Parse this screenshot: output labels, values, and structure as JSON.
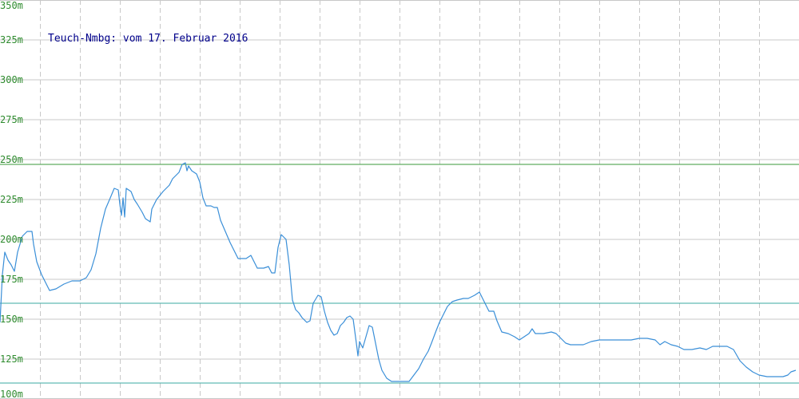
{
  "chart_data": {
    "type": "line",
    "title": "Teuch-Nmbg: vom 17. Februar 2016",
    "xlabel": "",
    "ylabel": "",
    "ylim": [
      100,
      350
    ],
    "y_ticks": [
      {
        "value": 350,
        "label": "350m"
      },
      {
        "value": 325,
        "label": "325m"
      },
      {
        "value": 300,
        "label": "300m"
      },
      {
        "value": 275,
        "label": "275m"
      },
      {
        "value": 250,
        "label": "250m"
      },
      {
        "value": 225,
        "label": "225m"
      },
      {
        "value": 200,
        "label": "200m"
      },
      {
        "value": 175,
        "label": "175m"
      },
      {
        "value": 150,
        "label": "150m"
      },
      {
        "value": 125,
        "label": "125m"
      },
      {
        "value": 100,
        "label": "100m"
      }
    ],
    "grid": true,
    "reference_lines": [
      {
        "value": 247,
        "color": "#3a9a3a"
      },
      {
        "value": 160,
        "color": "#3aa8a0"
      },
      {
        "value": 110,
        "color": "#3aa8a0"
      }
    ],
    "colors": {
      "line": "#3a8fd8",
      "grid": "#c8c8c8",
      "tick_label": "#2e8b2e",
      "title": "#00008b"
    },
    "series": [
      {
        "values": [
          [
            0,
            148
          ],
          [
            3,
            178
          ],
          [
            6,
            192
          ],
          [
            10,
            187
          ],
          [
            14,
            184
          ],
          [
            18,
            180
          ],
          [
            22,
            192
          ],
          [
            28,
            202
          ],
          [
            34,
            205
          ],
          [
            40,
            205
          ],
          [
            42,
            197
          ],
          [
            46,
            186
          ],
          [
            52,
            178
          ],
          [
            58,
            172
          ],
          [
            62,
            168
          ],
          [
            70,
            169
          ],
          [
            80,
            172
          ],
          [
            90,
            174
          ],
          [
            100,
            174
          ],
          [
            108,
            176
          ],
          [
            114,
            181
          ],
          [
            120,
            191
          ],
          [
            126,
            207
          ],
          [
            132,
            219
          ],
          [
            138,
            226
          ],
          [
            143,
            232
          ],
          [
            148,
            231
          ],
          [
            150,
            222
          ],
          [
            152,
            215
          ],
          [
            154,
            226
          ],
          [
            156,
            214
          ],
          [
            158,
            232
          ],
          [
            164,
            230
          ],
          [
            168,
            225
          ],
          [
            172,
            222
          ],
          [
            178,
            217
          ],
          [
            182,
            213
          ],
          [
            188,
            211
          ],
          [
            190,
            219
          ],
          [
            196,
            225
          ],
          [
            204,
            230
          ],
          [
            208,
            232
          ],
          [
            212,
            234
          ],
          [
            216,
            238
          ],
          [
            220,
            240
          ],
          [
            224,
            242
          ],
          [
            228,
            247
          ],
          [
            232,
            248
          ],
          [
            234,
            243
          ],
          [
            236,
            246
          ],
          [
            240,
            243
          ],
          [
            246,
            241
          ],
          [
            250,
            236
          ],
          [
            254,
            226
          ],
          [
            258,
            221
          ],
          [
            264,
            221
          ],
          [
            268,
            220
          ],
          [
            272,
            220
          ],
          [
            276,
            212
          ],
          [
            282,
            205
          ],
          [
            288,
            198
          ],
          [
            292,
            194
          ],
          [
            298,
            188
          ],
          [
            308,
            188
          ],
          [
            314,
            190
          ],
          [
            318,
            186
          ],
          [
            322,
            182
          ],
          [
            330,
            182
          ],
          [
            336,
            183
          ],
          [
            340,
            179
          ],
          [
            344,
            179
          ],
          [
            348,
            195
          ],
          [
            352,
            203
          ],
          [
            358,
            200
          ],
          [
            362,
            184
          ],
          [
            366,
            162
          ],
          [
            370,
            156
          ],
          [
            374,
            154
          ],
          [
            378,
            151
          ],
          [
            384,
            148
          ],
          [
            388,
            149
          ],
          [
            392,
            160
          ],
          [
            398,
            165
          ],
          [
            402,
            164
          ],
          [
            406,
            155
          ],
          [
            410,
            148
          ],
          [
            414,
            143
          ],
          [
            418,
            140
          ],
          [
            422,
            141
          ],
          [
            426,
            146
          ],
          [
            430,
            148
          ],
          [
            434,
            151
          ],
          [
            438,
            152
          ],
          [
            442,
            150
          ],
          [
            446,
            135
          ],
          [
            448,
            127
          ],
          [
            450,
            136
          ],
          [
            454,
            132
          ],
          [
            458,
            139
          ],
          [
            462,
            146
          ],
          [
            466,
            145
          ],
          [
            470,
            135
          ],
          [
            474,
            125
          ],
          [
            478,
            118
          ],
          [
            484,
            113
          ],
          [
            490,
            111
          ],
          [
            498,
            111
          ],
          [
            506,
            111
          ],
          [
            512,
            111
          ],
          [
            518,
            115
          ],
          [
            524,
            119
          ],
          [
            530,
            125
          ],
          [
            536,
            130
          ],
          [
            540,
            135
          ],
          [
            546,
            143
          ],
          [
            550,
            148
          ],
          [
            556,
            154
          ],
          [
            560,
            158
          ],
          [
            566,
            161
          ],
          [
            572,
            162
          ],
          [
            580,
            163
          ],
          [
            586,
            163
          ],
          [
            594,
            165
          ],
          [
            600,
            167
          ],
          [
            606,
            161
          ],
          [
            612,
            155
          ],
          [
            618,
            155
          ],
          [
            622,
            149
          ],
          [
            628,
            142
          ],
          [
            636,
            141
          ],
          [
            644,
            139
          ],
          [
            650,
            137
          ],
          [
            656,
            139
          ],
          [
            662,
            141
          ],
          [
            666,
            144
          ],
          [
            670,
            141
          ],
          [
            680,
            141
          ],
          [
            690,
            142
          ],
          [
            696,
            141
          ],
          [
            700,
            139
          ],
          [
            708,
            135
          ],
          [
            714,
            134
          ],
          [
            720,
            134
          ],
          [
            730,
            134
          ],
          [
            740,
            136
          ],
          [
            750,
            137
          ],
          [
            760,
            137
          ],
          [
            770,
            137
          ],
          [
            780,
            137
          ],
          [
            790,
            137
          ],
          [
            800,
            138
          ],
          [
            810,
            138
          ],
          [
            820,
            137
          ],
          [
            826,
            134
          ],
          [
            832,
            136
          ],
          [
            840,
            134
          ],
          [
            848,
            133
          ],
          [
            856,
            131
          ],
          [
            866,
            131
          ],
          [
            876,
            132
          ],
          [
            884,
            131
          ],
          [
            892,
            133
          ],
          [
            900,
            133
          ],
          [
            910,
            133
          ],
          [
            918,
            131
          ],
          [
            926,
            124
          ],
          [
            934,
            120
          ],
          [
            942,
            117
          ],
          [
            950,
            115
          ],
          [
            960,
            114
          ],
          [
            970,
            114
          ],
          [
            980,
            114
          ],
          [
            986,
            115
          ],
          [
            990,
            117
          ],
          [
            996,
            118
          ]
        ]
      }
    ]
  }
}
